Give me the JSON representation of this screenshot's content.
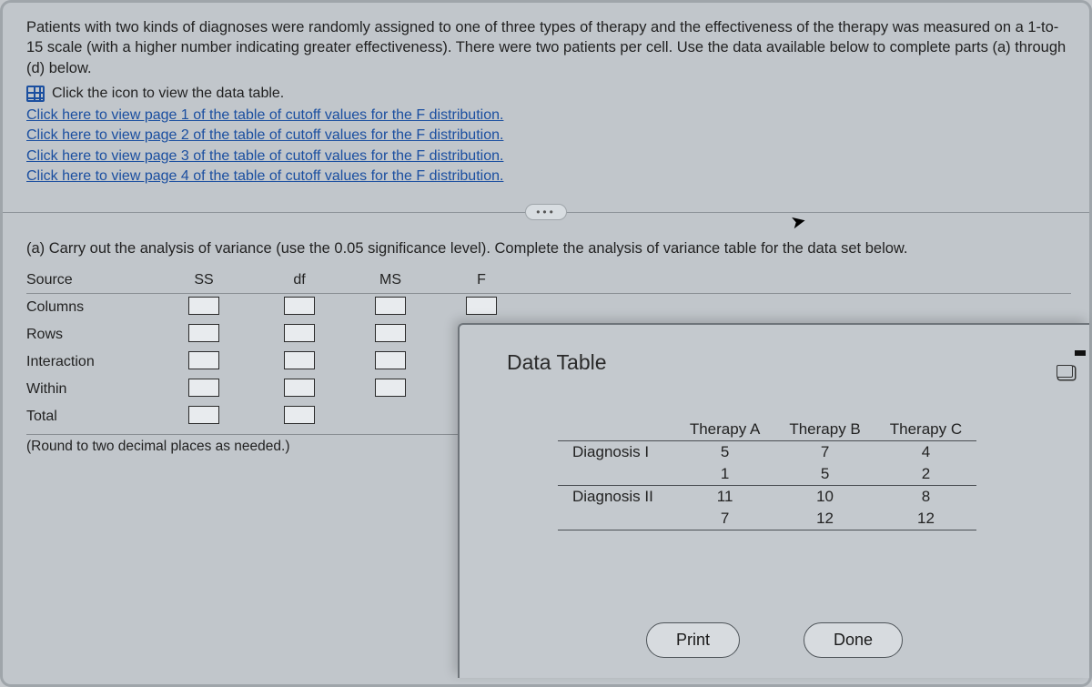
{
  "problem": {
    "text": "Patients with two kinds of diagnoses were randomly assigned to one of three types of therapy and the effectiveness of the therapy was measured on a 1-to-15 scale (with a higher number indicating greater effectiveness). There were two patients per cell. Use the data available below to complete parts (a) through (d) below.",
    "icon_line": "Click the icon to view the data table."
  },
  "links": {
    "p1": "Click here to view page 1 of the table of cutoff values for the F distribution.",
    "p2": "Click here to view page 2 of the table of cutoff values for the F distribution.",
    "p3": "Click here to view page 3 of the table of cutoff values for the F distribution.",
    "p4": "Click here to view page 4 of the table of cutoff values for the F distribution."
  },
  "partA": "(a) Carry out the analysis of variance (use the 0.05 significance level). Complete the analysis of variance table for the data set below.",
  "anova": {
    "headers": {
      "source": "Source",
      "ss": "SS",
      "df": "df",
      "ms": "MS",
      "f": "F"
    },
    "rows": {
      "columns": "Columns",
      "rows": "Rows",
      "interaction": "Interaction",
      "within": "Within",
      "total": "Total"
    },
    "round_note": "(Round to two decimal places as needed.)"
  },
  "modal": {
    "title": "Data Table",
    "headers": {
      "blank": "",
      "a": "Therapy A",
      "b": "Therapy B",
      "c": "Therapy C"
    },
    "rows": [
      {
        "label": "Diagnosis I",
        "a1": "5",
        "b1": "7",
        "c1": "4"
      },
      {
        "label": "",
        "a1": "1",
        "b1": "5",
        "c1": "2"
      },
      {
        "label": "Diagnosis II",
        "a1": "11",
        "b1": "10",
        "c1": "8"
      },
      {
        "label": "",
        "a1": "7",
        "b1": "12",
        "c1": "12"
      }
    ],
    "print": "Print",
    "done": "Done"
  },
  "chart_data": {
    "type": "table",
    "title": "Data Table",
    "columns": [
      "",
      "Therapy A",
      "Therapy B",
      "Therapy C"
    ],
    "rows": [
      [
        "Diagnosis I",
        5,
        7,
        4
      ],
      [
        "Diagnosis I",
        1,
        5,
        2
      ],
      [
        "Diagnosis II",
        11,
        10,
        8
      ],
      [
        "Diagnosis II",
        7,
        12,
        12
      ]
    ]
  }
}
